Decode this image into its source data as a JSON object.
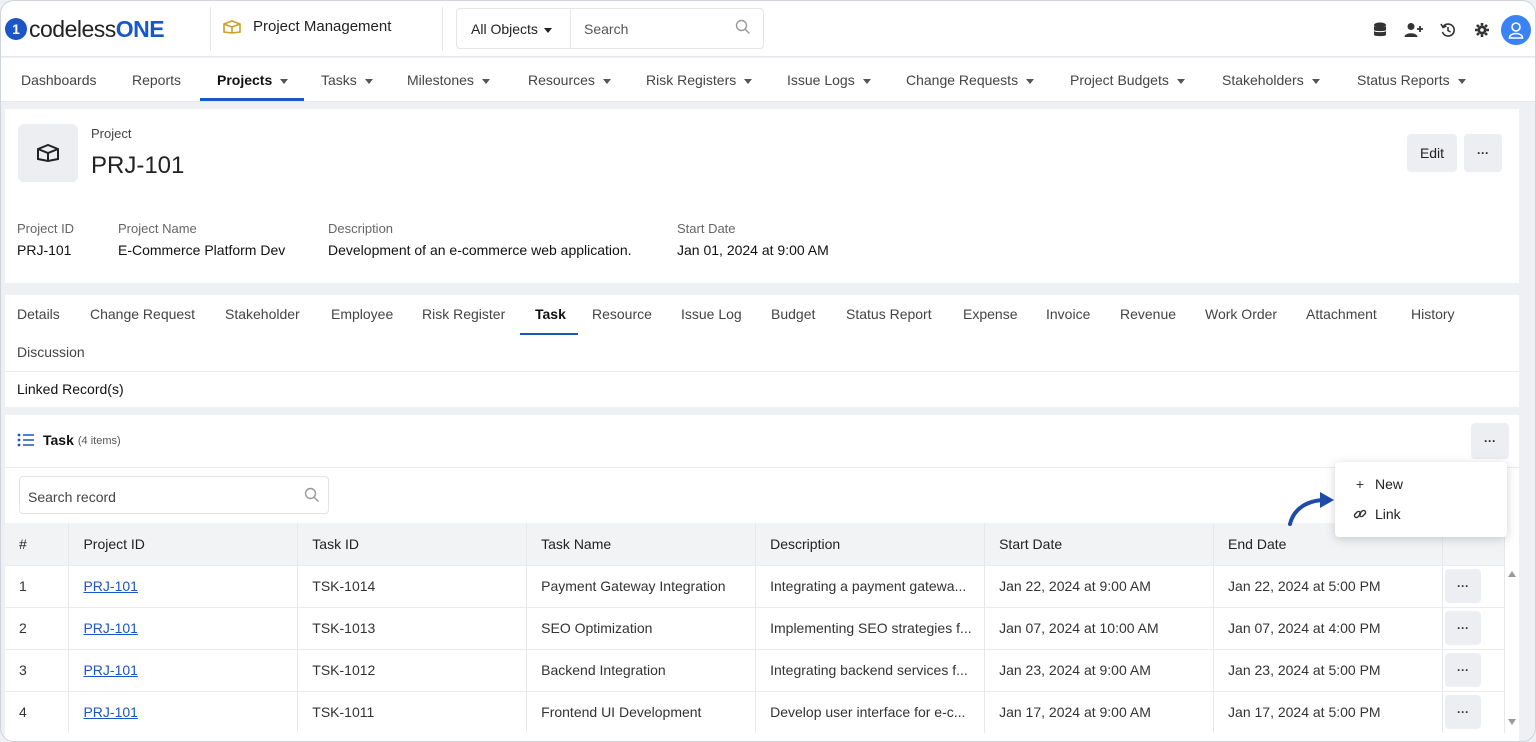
{
  "brand": {
    "logo_mark": "1",
    "name_part1": "codeless",
    "name_part2": "ONE"
  },
  "app": {
    "title": "Project Management",
    "icon": "cube-icon"
  },
  "search": {
    "scope": "All Objects",
    "placeholder": "Search"
  },
  "top_icons": [
    "database-icon",
    "add-user-icon",
    "history-icon",
    "gear-icon",
    "user-avatar-icon"
  ],
  "nav": {
    "items": [
      "Dashboards",
      "Reports",
      "Projects",
      "Tasks",
      "Milestones",
      "Resources",
      "Risk Registers",
      "Issue Logs",
      "Change Requests",
      "Project Budgets",
      "Stakeholders",
      "Status Reports"
    ],
    "active": "Projects"
  },
  "project": {
    "label": "Project",
    "title": "PRJ-101",
    "edit_label": "Edit",
    "more_label": "···",
    "fields": [
      {
        "label": "Project ID",
        "value": "PRJ-101"
      },
      {
        "label": "Project Name",
        "value": "E-Commerce Platform Dev"
      },
      {
        "label": "Description",
        "value": "Development of an e-commerce web application."
      },
      {
        "label": "Start Date",
        "value": "Jan 01, 2024 at 9:00 AM"
      }
    ]
  },
  "tabs": {
    "items": [
      "Details",
      "Change Request",
      "Stakeholder",
      "Employee",
      "Risk Register",
      "Task",
      "Resource",
      "Issue Log",
      "Budget",
      "Status Report",
      "Expense",
      "Invoice",
      "Revenue",
      "Work Order",
      "Attachment",
      "History",
      "Discussion"
    ],
    "active": "Task",
    "linked_records": "Linked Record(s)"
  },
  "task_panel": {
    "title": "Task",
    "count": "(4 items)",
    "more_label": "···",
    "search_placeholder": "Search record",
    "columns": [
      "#",
      "Project ID",
      "Task ID",
      "Task Name",
      "Description",
      "Start Date",
      "End Date"
    ],
    "rows": [
      {
        "num": "1",
        "project_id": "PRJ-101",
        "task_id": "TSK-1014",
        "task_name": "Payment Gateway Integration",
        "description": "Integrating a payment gatewa...",
        "start": "Jan 22, 2024 at 9:00 AM",
        "end": "Jan 22, 2024 at 5:00 PM"
      },
      {
        "num": "2",
        "project_id": "PRJ-101",
        "task_id": "TSK-1013",
        "task_name": "SEO Optimization",
        "description": "Implementing SEO strategies f...",
        "start": "Jan 07, 2024 at 10:00 AM",
        "end": "Jan 07, 2024 at 4:00 PM"
      },
      {
        "num": "3",
        "project_id": "PRJ-101",
        "task_id": "TSK-1012",
        "task_name": "Backend Integration",
        "description": "Integrating backend services f...",
        "start": "Jan 23, 2024 at 9:00 AM",
        "end": "Jan 23, 2024 at 5:00 PM"
      },
      {
        "num": "4",
        "project_id": "PRJ-101",
        "task_id": "TSK-1011",
        "task_name": "Frontend UI Development",
        "description": "Develop user interface for e-c...",
        "start": "Jan 17, 2024 at 9:00 AM",
        "end": "Jan 17, 2024 at 5:00 PM"
      }
    ],
    "row_more_label": "···"
  },
  "menu": {
    "items": [
      {
        "icon": "plus-icon",
        "glyph": "+",
        "label": "New"
      },
      {
        "icon": "link-icon",
        "glyph": "",
        "label": "Link"
      }
    ]
  },
  "colors": {
    "accent": "#1b56c6",
    "avatar": "#3b82f6"
  }
}
